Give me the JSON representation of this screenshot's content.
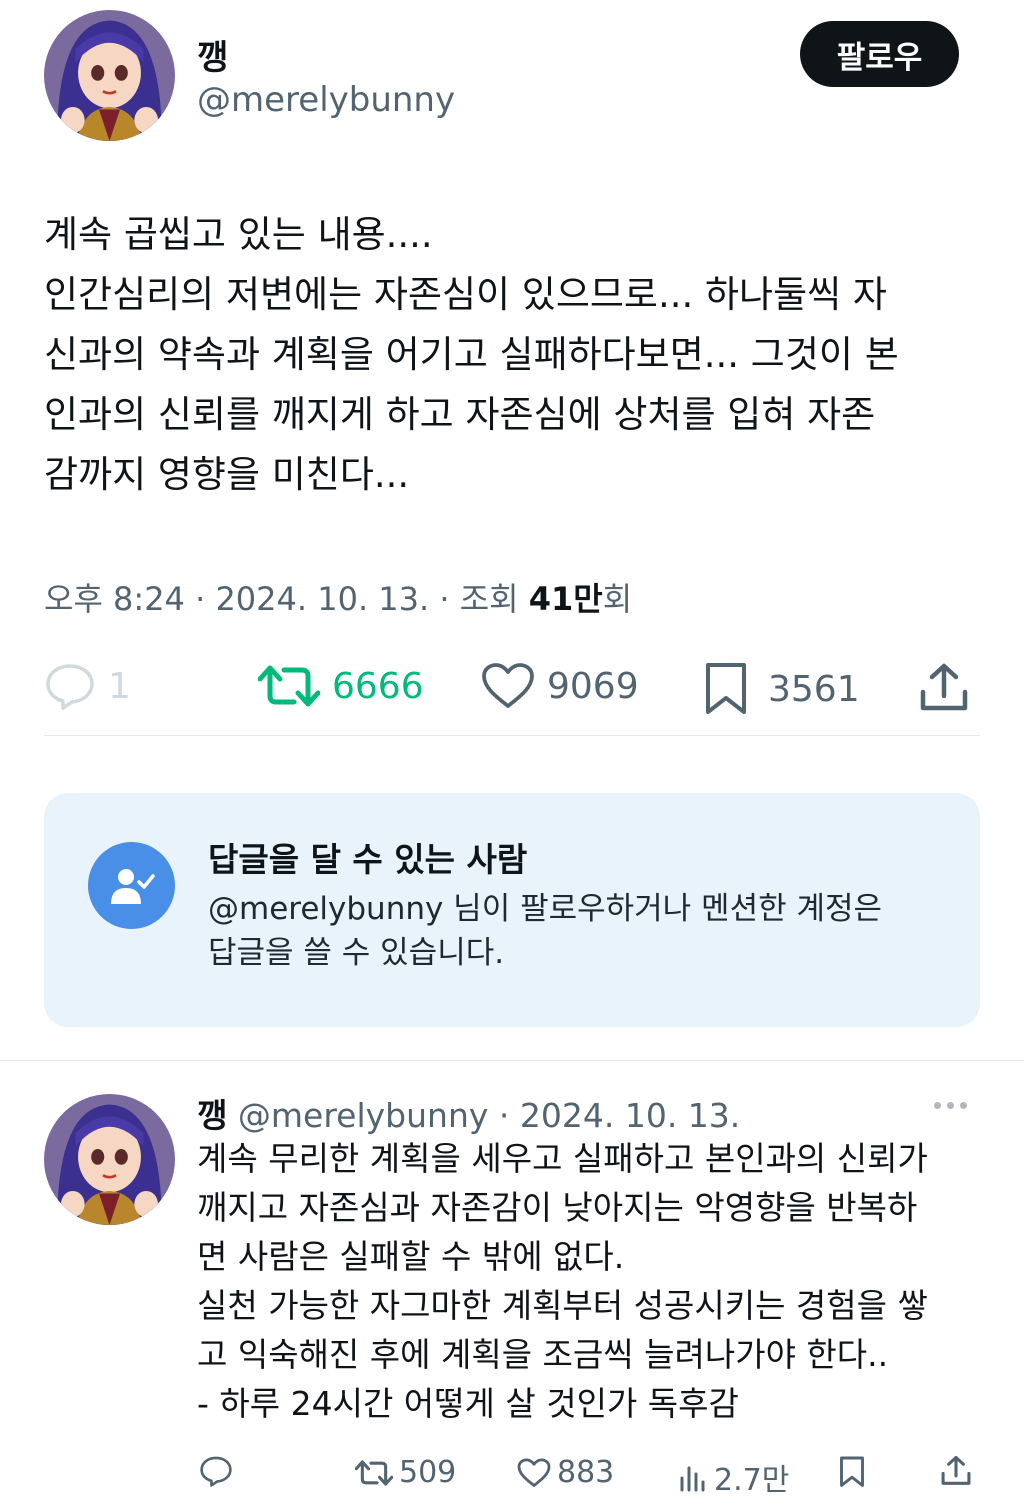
{
  "tweet": {
    "author_name": "깽",
    "author_handle": "@merelybunny",
    "follow_label": "팔로우",
    "body_lines": [
      "계속 곱씹고 있는 내용....",
      "인간심리의 저변에는 자존심이 있으므로... 하나둘씩 자",
      "신과의 약속과 계획을 어기고 실패하다보면... 그것이 본",
      "인과의 신뢰를 깨지게 하고 자존심에 상처를 입혀 자존",
      "감까지 영향을 미친다..."
    ],
    "time": "오후 8:24",
    "date": "2024. 10. 13.",
    "views_label": "조회",
    "views_count": "41만",
    "views_suffix": "회",
    "stats": {
      "replies": "1",
      "retweets": "6666",
      "likes": "9069",
      "bookmarks": "3561"
    }
  },
  "reply_restriction": {
    "title": "답글을 달 수 있는 사람",
    "desc_lines": [
      "@merelybunny 님이 팔로우하거나 멘션한 계정은",
      "답글을 쓸 수 있습니다."
    ]
  },
  "reply": {
    "author_name": "깽",
    "author_handle": "@merelybunny",
    "date": "2024. 10. 13.",
    "body_lines": [
      "계속 무리한 계획을 세우고 실패하고 본인과의 신뢰가",
      "깨지고 자존심과 자존감이 낮아지는 악영향을 반복하",
      "면 사람은 실패할 수 밖에 없다.",
      "실천 가능한 자그마한 계획부터 성공시키는 경험을 쌓",
      "고 익숙해진 후에 계획을 조금씩 늘려나가야 한다..",
      "- 하루 24시간 어떻게 살 것인가 독후감"
    ],
    "stats": {
      "retweets": "509",
      "likes": "883",
      "views": "2.7만"
    }
  },
  "colors": {
    "text": "#0f1419",
    "secondary": "#536471",
    "retweet_green": "#00ba7c",
    "info_box_bg": "#e8f3fb",
    "info_icon_blue": "#4a8fe7",
    "follow_bg": "#0f1419"
  },
  "icons": [
    "reply-icon",
    "retweet-icon",
    "heart-icon",
    "bookmark-icon",
    "share-icon",
    "views-icon",
    "more-icon",
    "person-check-icon"
  ]
}
